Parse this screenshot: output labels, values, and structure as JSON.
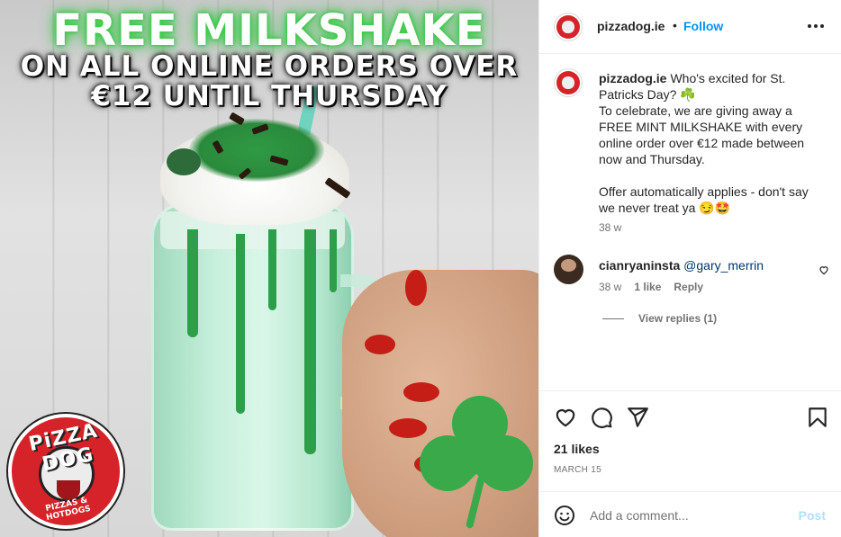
{
  "post_image": {
    "headline_line1": "FREE MILKSHAKE",
    "headline_line2": "ON ALL ONLINE ORDERS OVER",
    "headline_line3": "€12 UNTIL THURSDAY",
    "logo_top": "PiZZA DOG",
    "logo_bottom": "PIZZAS & HOTDOGS"
  },
  "header": {
    "username": "pizzadog.ie",
    "separator": "•",
    "follow_label": "Follow",
    "avatar_icon": "pizzadog-logo-avatar",
    "more_icon": "more-horizontal-icon"
  },
  "caption": {
    "username": "pizzadog.ie",
    "text": "Who's excited for St. Patricks Day? ☘️\nTo celebrate, we are giving away a FREE MINT MILKSHAKE with every online order over €12 made between now and Thursday.\n\nOffer automatically applies - don't say we never treat ya 😏🤩",
    "age": "38 w"
  },
  "comments": [
    {
      "username": "cianryaninsta",
      "mention": "@gary_merrin",
      "age": "38 w",
      "likes": "1 like",
      "reply_label": "Reply",
      "view_replies": "View replies (1)"
    }
  ],
  "actions": {
    "icons": [
      "heart-icon",
      "comment-icon",
      "share-icon",
      "bookmark-icon"
    ],
    "likes": "21 likes",
    "date": "MARCH 15"
  },
  "add_comment": {
    "placeholder": "Add a comment...",
    "post_label": "Post",
    "emoji_icon": "smile-icon"
  },
  "colors": {
    "link_blue": "#0095f6",
    "post_disabled": "#b2dffc",
    "mention": "#00376b",
    "brand_red": "#d6232a",
    "shamrock_green": "#3aa94a"
  }
}
